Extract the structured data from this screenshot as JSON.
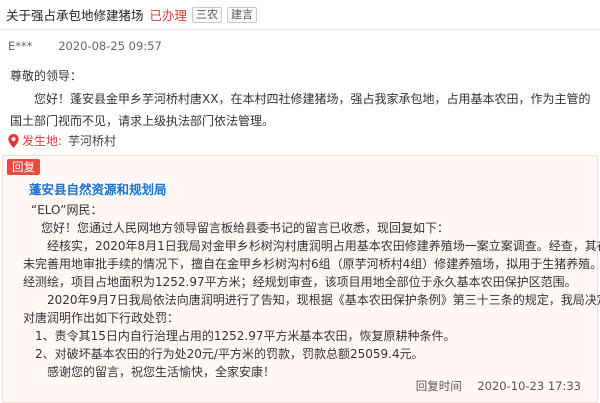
{
  "header": {
    "title": "关于强占承包地修建猪场",
    "status": "已办理",
    "tags": [
      "三农",
      "建言"
    ]
  },
  "meta": {
    "author": "E***",
    "time": "2020-08-25 09:57"
  },
  "message": {
    "salutation": "尊敬的领导：",
    "paragraph": "您好！蓬安县金甲乡芋河桥村唐XX，在本村四社修建猪场，强占我家承包地，占用基本农田，作为主管的国土部门视而不见，请求上级执法部门依法管理。",
    "location_label": "发生地:",
    "location_value": "芋河桥村"
  },
  "reply": {
    "tag": "回复",
    "org": "蓬安县自然资源和规划局",
    "lines": [
      "“ELO”网民：",
      "您好！您通过人民网地方领导留言板给县委书记的留言已收悉，现回复如下：",
      "经核实，2020年8月1日我局对金甲乡杉树沟村唐润明占用基本农田修建养殖场一案立案调查。经查，其在",
      "未完善用地审批手续的情况下，擅自在金甲乡杉树沟村6组（原芋河桥村4组）修建养殖场，拟用于生猪养殖。",
      "经测绘，项目占地面积为1252.97平方米；经规划审查，该项目用地全部位于永久基本农田保护区范围。",
      "2020年9月7日我局依法向唐润明进行了告知，现根据《基本农田保护条例》第三十三条的规定，我局决定",
      "对唐润明作出如下行政处罚：",
      "1、责令其15日内自行治理占用的1252.97平方米基本农田，恢复原耕种条件。",
      "2、对破坏基本农田的行为处20元/平方米的罚款，罚款总额25059.4元。",
      "感谢您的留言，祝您生活愉快，全家安康！"
    ],
    "time_label": "回复时间",
    "time_value": "2020-10-23 17:33"
  },
  "colors": {
    "status_red": "#e03a3a",
    "org_blue": "#1a73c9",
    "reply_bg": "#fff8f6",
    "reply_tag_bg": "#e94b3c"
  },
  "icons": {
    "location": "map-pin-icon"
  }
}
